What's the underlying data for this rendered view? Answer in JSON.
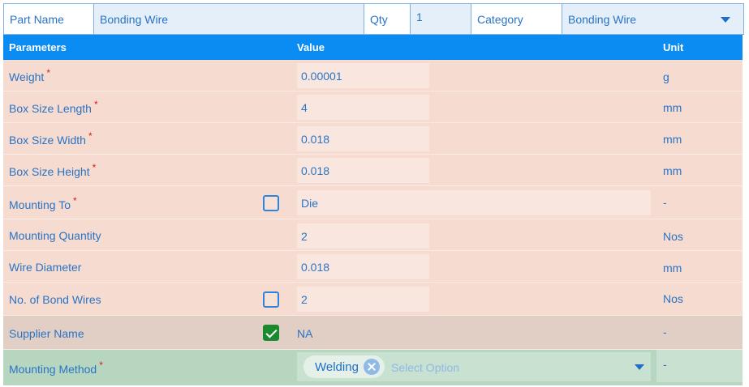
{
  "header": {
    "part_name_label": "Part Name",
    "part_name_value": "Bonding Wire",
    "qty_label": "Qty",
    "qty_value": "1",
    "category_label": "Category",
    "category_value": "Bonding Wire"
  },
  "table_header": {
    "parameters": "Parameters",
    "value": "Value",
    "unit": "Unit"
  },
  "rows": [
    {
      "label": "Weight",
      "required": "*",
      "value": "0.00001",
      "unit": "g"
    },
    {
      "label": "Box Size Length",
      "required": "*",
      "value": "4",
      "unit": "mm"
    },
    {
      "label": "Box Size Width",
      "required": "*",
      "value": "0.018",
      "unit": "mm"
    },
    {
      "label": "Box Size Height",
      "required": "*",
      "value": "0.018",
      "unit": "mm"
    },
    {
      "label": "Mounting To",
      "required": "*",
      "value": "Die",
      "unit": "-",
      "checked": false
    },
    {
      "label": "Mounting Quantity",
      "value": "2",
      "unit": "Nos"
    },
    {
      "label": "Wire Diameter",
      "value": "0.018",
      "unit": "mm"
    },
    {
      "label": "No. of Bond Wires",
      "value": "2",
      "unit": "Nos",
      "checked": false
    },
    {
      "label": "Supplier Name",
      "value": "NA",
      "unit": "-",
      "checked": true
    }
  ],
  "mounting_method": {
    "label": "Mounting Method",
    "required": "*",
    "chip": "Welding",
    "placeholder": "Select Option",
    "unit": "-"
  },
  "colors": {
    "header_blue": "#0b8cf3",
    "row_bg": "#f5dbd0",
    "checked_green": "#1a8a2e",
    "text_blue": "#2a73c5",
    "required_red": "#e01b1b"
  }
}
